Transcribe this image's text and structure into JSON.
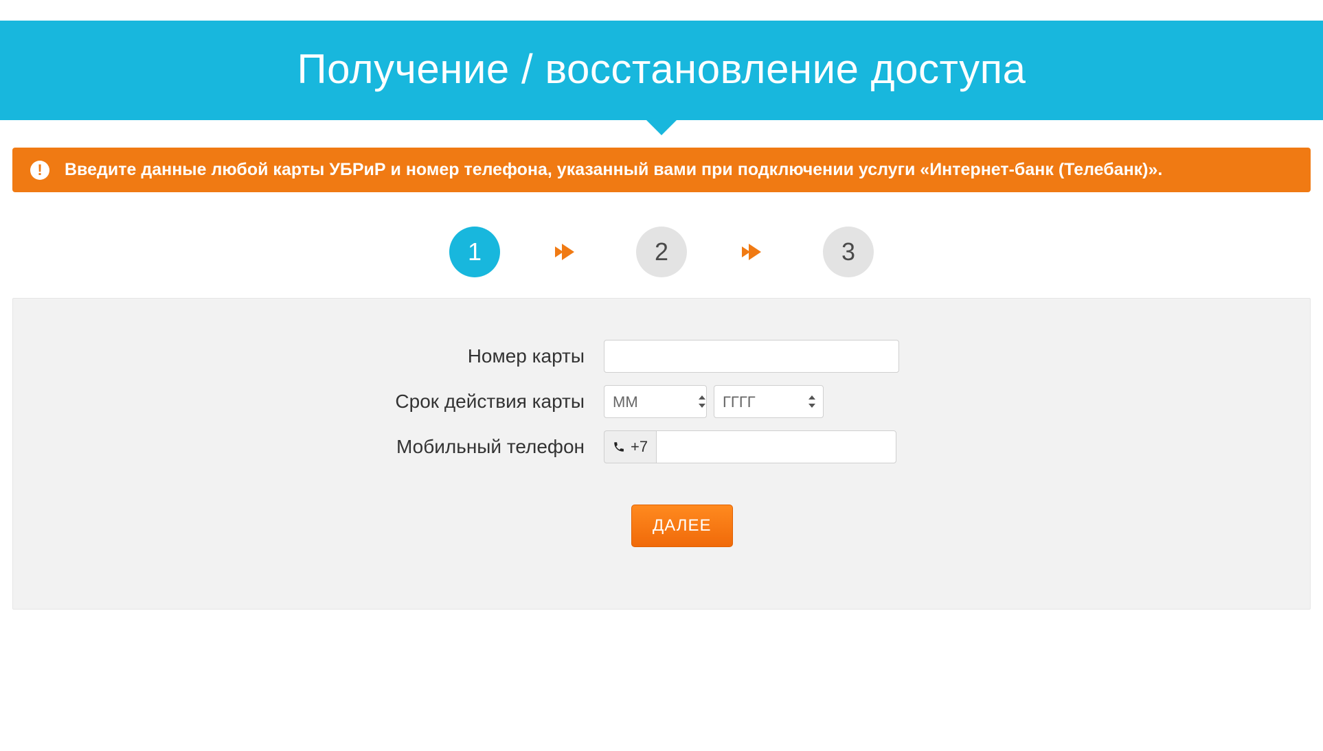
{
  "header": {
    "title": "Получение / восстановление доступа"
  },
  "alert": {
    "text": "Введите данные любой карты УБРиР и номер телефона, указанный вами при подключении услуги «Интернет-банк (Телебанк)».",
    "icon_glyph": "!"
  },
  "steps": {
    "items": [
      {
        "label": "1",
        "active": true
      },
      {
        "label": "2",
        "active": false
      },
      {
        "label": "3",
        "active": false
      }
    ]
  },
  "form": {
    "card_number": {
      "label": "Номер карты",
      "value": ""
    },
    "card_expiry": {
      "label": "Срок действия карты",
      "month_placeholder": "ММ",
      "year_placeholder": "ГГГГ"
    },
    "phone": {
      "label": "Мобильный телефон",
      "prefix": "+7",
      "value": ""
    },
    "submit_label": "ДАЛЕЕ"
  },
  "colors": {
    "accent_blue": "#18b7dd",
    "accent_orange": "#f07a13"
  }
}
